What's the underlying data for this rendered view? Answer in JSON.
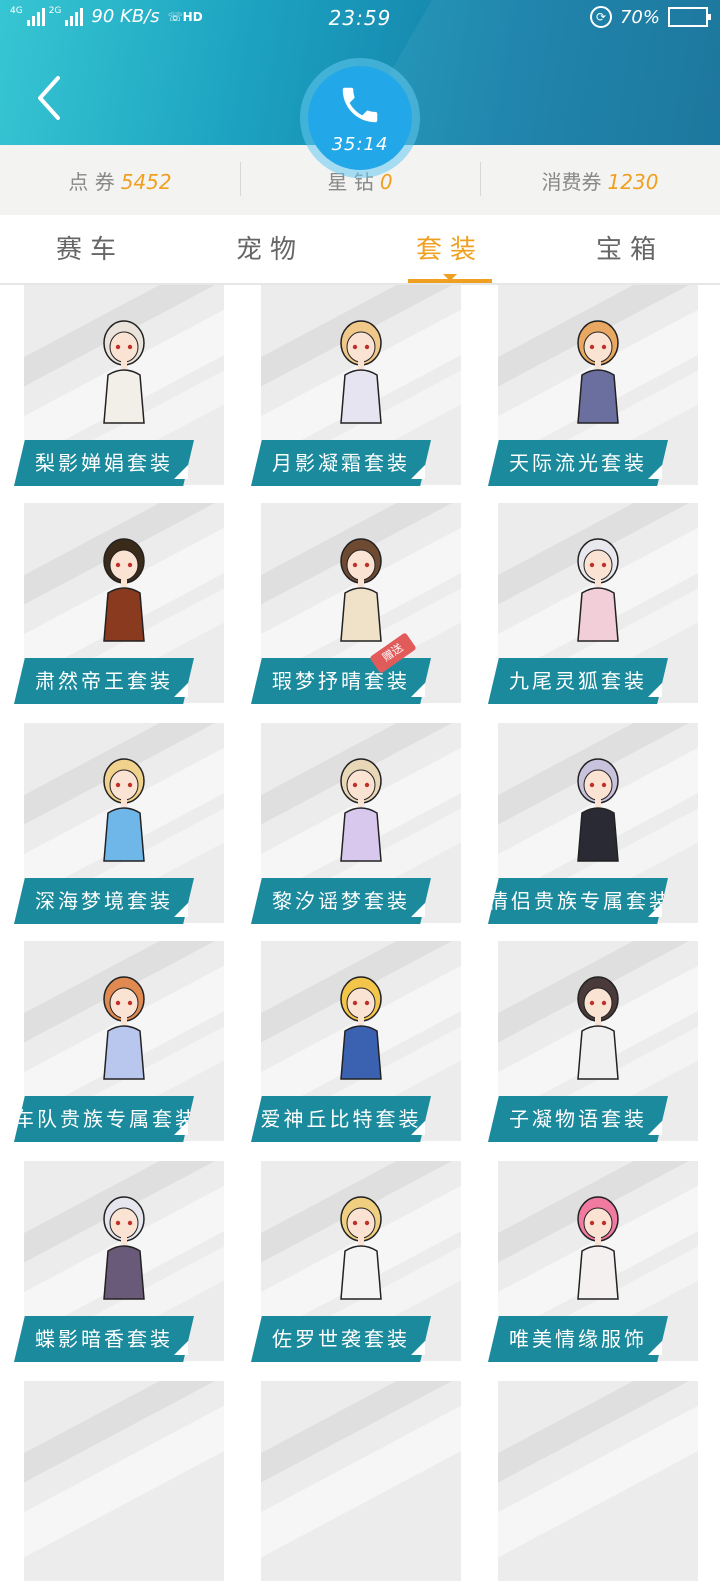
{
  "status_bar": {
    "network1": "4G",
    "network2": "2G",
    "speed": "90 KB/s",
    "hd": "HD",
    "time": "23:59",
    "battery": "70%",
    "battery_level": 0.7
  },
  "call": {
    "duration": "35:14"
  },
  "stats": [
    {
      "label": "点 券",
      "value": "5452"
    },
    {
      "label": "星 钻",
      "value": "0"
    },
    {
      "label": "消费券",
      "value": "1230"
    }
  ],
  "tabs": [
    {
      "label": "赛车",
      "active": false
    },
    {
      "label": "宠物",
      "active": false
    },
    {
      "label": "套装",
      "active": true
    },
    {
      "label": "宝箱",
      "active": false
    }
  ],
  "items": [
    {
      "name": "梨影婵娟套装",
      "hair": "#e9e3dc",
      "outfit": "#f2efe8"
    },
    {
      "name": "月影凝霜套装",
      "hair": "#f0c98a",
      "outfit": "#e6e4f0"
    },
    {
      "name": "天际流光套装",
      "hair": "#e8a861",
      "outfit": "#6b6fa0"
    },
    {
      "name": "肃然帝王套装",
      "hair": "#3a2a1a",
      "outfit": "#8a3a1e"
    },
    {
      "name": "瑕梦抒晴套装",
      "hair": "#6e4a32",
      "outfit": "#efe2c8",
      "badge": "赠送"
    },
    {
      "name": "九尾灵狐套装",
      "hair": "#e8e8ee",
      "outfit": "#f2cfd8"
    },
    {
      "name": "深海梦境套装",
      "hair": "#f1d28c",
      "outfit": "#6fb7e8"
    },
    {
      "name": "黎汐谣梦套装",
      "hair": "#e8d8b8",
      "outfit": "#d8c8ee"
    },
    {
      "name": "情侣贵族专属套装",
      "hair": "#c9c2dc",
      "outfit": "#2a2a34"
    },
    {
      "name": "车队贵族专属套装",
      "hair": "#e08a52",
      "outfit": "#b9c6ee"
    },
    {
      "name": "爱神丘比特套装",
      "hair": "#f3c64b",
      "outfit": "#3b62b0"
    },
    {
      "name": "子凝物语套装",
      "hair": "#4a3a3a",
      "outfit": "#f0f0f0"
    },
    {
      "name": "蝶影暗香套装",
      "hair": "#e6e6ee",
      "outfit": "#6a5a7a"
    },
    {
      "name": "佐罗世袭套装",
      "hair": "#f0d080",
      "outfit": "#f4f4f4"
    },
    {
      "name": "唯美情缘服饰",
      "hair": "#f07aa0",
      "outfit": "#f4f0f0"
    }
  ]
}
